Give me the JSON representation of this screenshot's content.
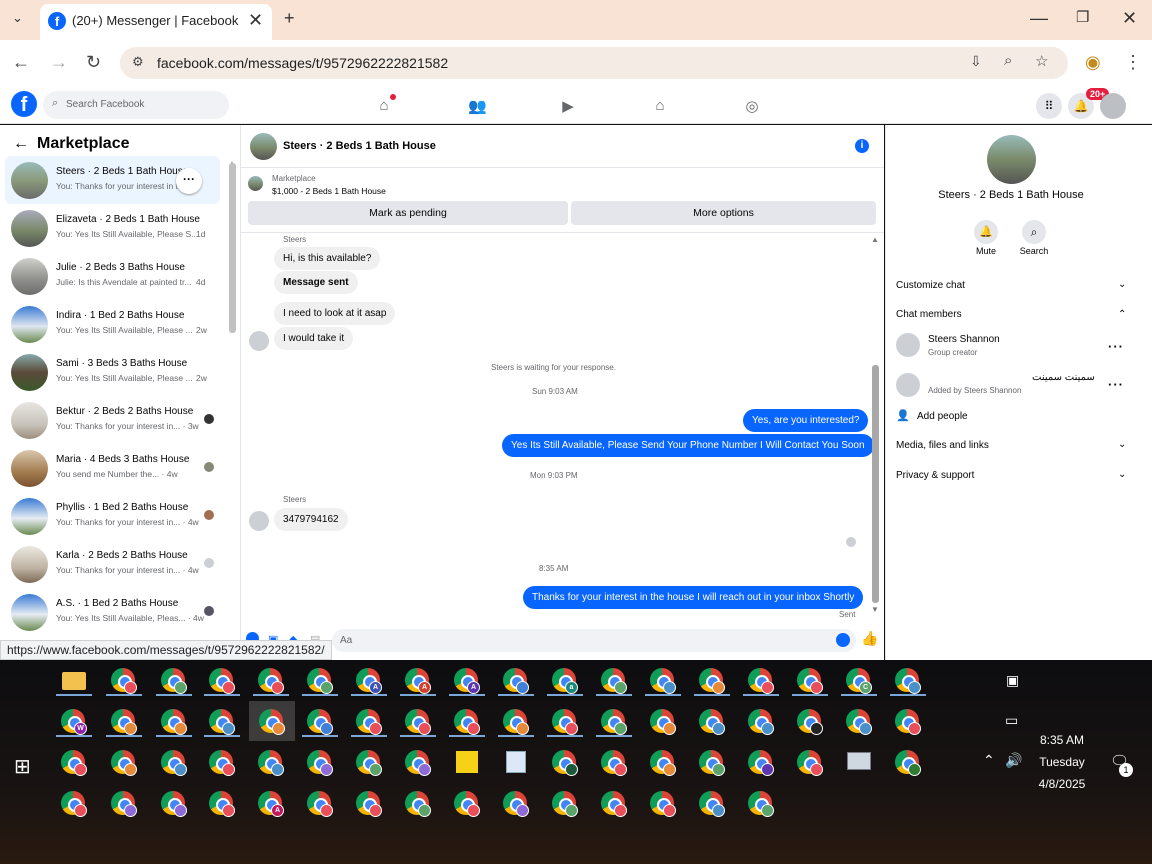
{
  "browser": {
    "tab_title": "(20+) Messenger | Facebook",
    "url": "facebook.com/messages/t/9572962222821582",
    "status_url": "https://www.facebook.com/messages/t/9572962222821582/"
  },
  "fb": {
    "logo_letter": "f",
    "search_placeholder": "Search Facebook",
    "notif_badge": "20+"
  },
  "left": {
    "heading": "Marketplace",
    "conversations": [
      {
        "title": "Steers · 2 Beds 1 Bath House",
        "preview": "You: Thanks for your interest in the",
        "time": "",
        "selected": true
      },
      {
        "title": "Elizaveta · 2 Beds 1 Bath House",
        "preview": "You: Yes Its Still Available, Please S...",
        "time": "1d"
      },
      {
        "title": "Julie · 2 Beds 3 Baths House",
        "preview": "Julie: Is this Avendale at painted tr...",
        "time": "4d"
      },
      {
        "title": "Indira · 1 Bed 2 Baths House",
        "preview": "You: Yes Its Still Available, Please ...",
        "time": "2w"
      },
      {
        "title": "Sami · 3 Beds 3 Baths House",
        "preview": "You: Yes Its Still Available, Please ...",
        "time": "2w"
      },
      {
        "title": "Bektur · 2 Beds 2 Baths House",
        "preview": "You: Thanks for your interest in... · 3w",
        "time": ""
      },
      {
        "title": "Maria · 4 Beds 3 Baths House",
        "preview": "You send me Number the... · 4w",
        "time": ""
      },
      {
        "title": "Phyllis · 1 Bed 2 Baths House",
        "preview": "You: Thanks for your interest in... · 4w",
        "time": ""
      },
      {
        "title": "Karla · 2 Beds 2 Baths House",
        "preview": "You: Thanks for your interest in... · 4w",
        "time": ""
      },
      {
        "title": "A.S. · 1 Bed 2 Baths House",
        "preview": "You: Yes Its Still Available, Pleas... · 4w",
        "time": ""
      }
    ]
  },
  "chat": {
    "title": "Steers · 2 Beds 1 Bath House",
    "listing_source": "Marketplace",
    "listing_title": "$1,000 - 2 Beds 1 Bath House",
    "btn_pending": "Mark as pending",
    "btn_more": "More options",
    "sender_name": "Steers",
    "msgs_in_1": [
      "Hi, is this available?",
      "Message sent",
      "I need to look at it asap",
      "I would take it"
    ],
    "waiting_note": "Steers is waiting for your response.",
    "time_1": "Sun 9:03 AM",
    "out_1": "Yes, are you interested?",
    "out_2": "Yes Its Still Available, Please Send Your Phone Number I Will Contact You Soon",
    "time_2": "Mon 9:03 PM",
    "sender_name_2": "Steers",
    "in_phone": "3479794162",
    "time_3": "8:35 AM",
    "out_3": "Thanks for your interest in the house I will reach out in your inbox Shortly",
    "sent_label": "Sent",
    "composer_placeholder": "Aa"
  },
  "right": {
    "title": "Steers · 2 Beds 1 Bath House",
    "mute": "Mute",
    "search": "Search",
    "customize": "Customize chat",
    "members": "Chat members",
    "member1_name": "Steers Shannon",
    "member1_role": "Group creator",
    "member2_name": "سمينت سمينت",
    "member2_role": "Added by Steers Shannon",
    "add_people": "Add people",
    "media": "Media, files and links",
    "privacy": "Privacy & support"
  },
  "taskbar": {
    "time": "8:35 AM",
    "day": "Tuesday",
    "date": "4/8/2025",
    "notif_count": "1"
  },
  "colors": {
    "fb_blue": "#0866ff",
    "tab_strip": "#f8e3d4",
    "red_badge": "#e41e3f"
  }
}
